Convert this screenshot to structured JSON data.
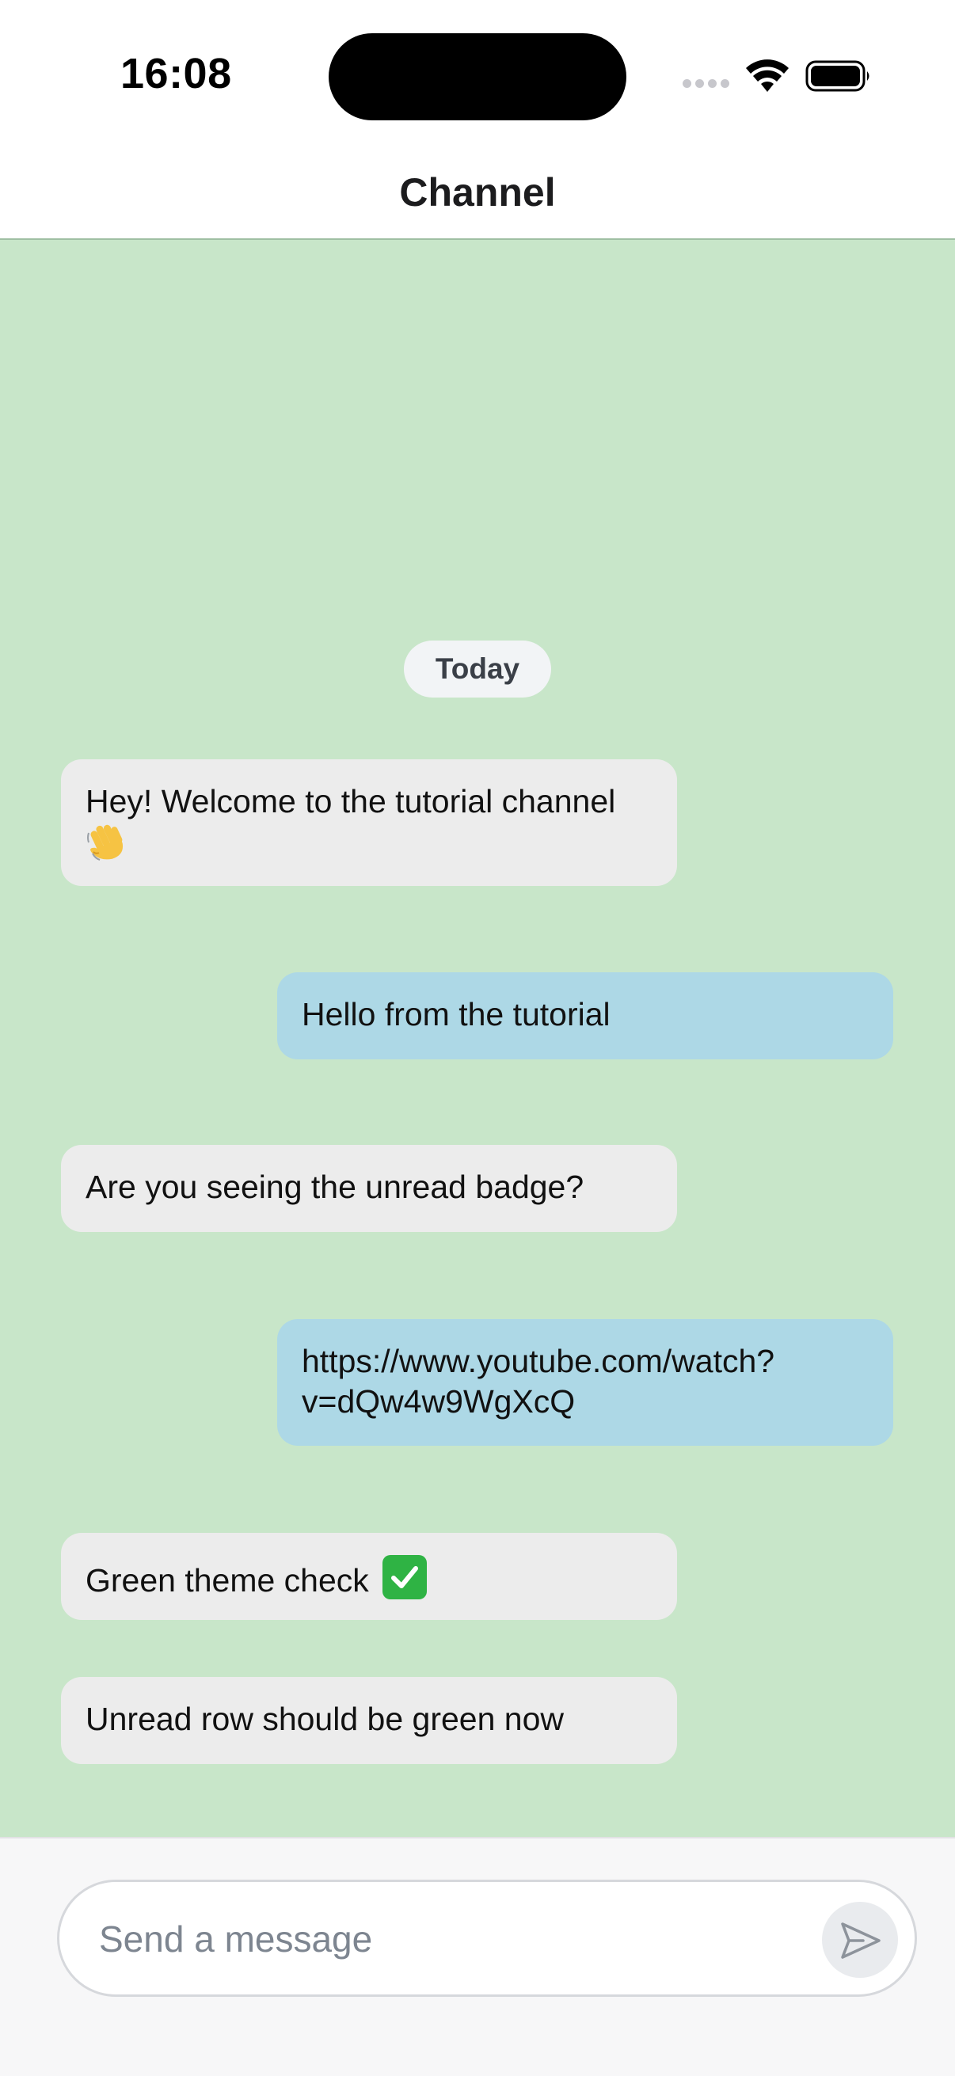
{
  "status_bar": {
    "time": "16:08"
  },
  "header": {
    "title": "Channel"
  },
  "messages": {
    "date_separator": "Today",
    "items": [
      {
        "direction": "incoming",
        "text": "Hey! Welcome to the tutorial channel",
        "emoji": "waving-hand"
      },
      {
        "direction": "outgoing",
        "text": "Hello from the tutorial"
      },
      {
        "direction": "incoming",
        "text": "Are you seeing the unread badge?"
      },
      {
        "direction": "outgoing",
        "text_line1": "https://www.youtube.com/watch?",
        "text_line2": "v=dQw4w9WgXcQ"
      },
      {
        "direction": "incoming",
        "text": "Green theme check",
        "emoji": "check-mark-button"
      },
      {
        "direction": "incoming",
        "text": "Unread row should be green now"
      }
    ]
  },
  "composer": {
    "placeholder": "Send a message",
    "value": ""
  },
  "colors": {
    "chat_background": "#c8e6c9",
    "incoming_bubble": "#ececec",
    "outgoing_bubble": "#add8e6",
    "header_background": "#ffffff"
  },
  "icons": {
    "signal": "cellular-signal-icon",
    "wifi": "wifi-icon",
    "battery": "battery-icon",
    "send": "send-paper-plane-icon"
  }
}
